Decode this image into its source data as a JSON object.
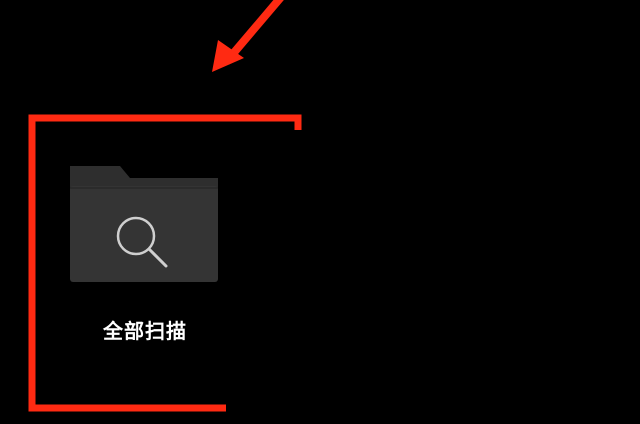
{
  "colors": {
    "background": "#000000",
    "annotation": "#ff2a12",
    "folder": "#343434",
    "folder_tab": "#2e2e2e",
    "icon_stroke": "#cfcfcf",
    "label": "#ffffff"
  },
  "tile": {
    "label": "全部扫描",
    "icon": "folder-search-icon"
  },
  "annotations": {
    "arrow_icon": "arrow-pointer-icon",
    "frame": "highlight-bracket"
  }
}
